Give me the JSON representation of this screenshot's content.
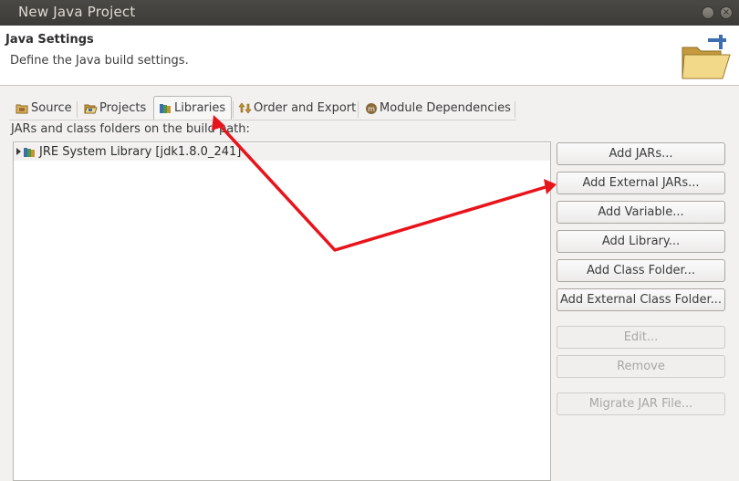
{
  "window": {
    "title": "New Java Project",
    "close_glyph": "×"
  },
  "header": {
    "title": "Java Settings",
    "description": "Define the Java build settings."
  },
  "tabs": [
    {
      "label": "Source",
      "icon": "source-folder-icon",
      "selected": false
    },
    {
      "label": "Projects",
      "icon": "projects-icon",
      "selected": false
    },
    {
      "label": "Libraries",
      "icon": "libraries-icon",
      "selected": true
    },
    {
      "label": "Order and Export",
      "icon": "order-export-icon",
      "selected": false
    },
    {
      "label": "Module Dependencies",
      "icon": "module-icon",
      "selected": false
    }
  ],
  "build_path": {
    "caption": "JARs and class folders on the build path:",
    "items": [
      {
        "label": "JRE System Library [jdk1.8.0_241]",
        "icon": "library-icon",
        "expanded": false
      }
    ]
  },
  "buttons": [
    {
      "label": "Add JARs...",
      "enabled": true
    },
    {
      "label": "Add External JARs...",
      "enabled": true
    },
    {
      "label": "Add Variable...",
      "enabled": true
    },
    {
      "label": "Add Library...",
      "enabled": true
    },
    {
      "label": "Add Class Folder...",
      "enabled": true
    },
    {
      "label": "Add External Class Folder...",
      "enabled": true
    },
    {
      "label": "Edit...",
      "enabled": false
    },
    {
      "label": "Remove",
      "enabled": false
    },
    {
      "label": "Migrate JAR File...",
      "enabled": false
    }
  ],
  "colors": {
    "annotation_arrow": "#e8141c",
    "titlebar": "#3c3b37",
    "dialog_bg": "#f2f1f0"
  }
}
